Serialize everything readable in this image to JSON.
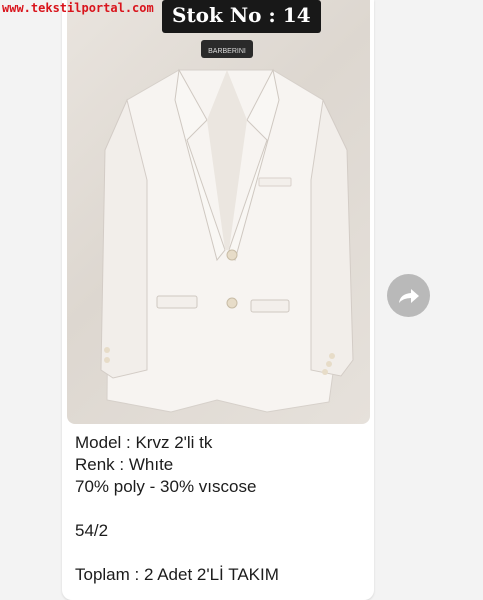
{
  "watermark": "www.tekstilportal.com",
  "badge": {
    "label": "Stok No : 14"
  },
  "photo": {
    "hanger_brand": "BARBERINI",
    "icon": "suit-jacket-photo"
  },
  "forward": {
    "icon": "forward-arrow-icon"
  },
  "caption": {
    "model": "Model : Krvz 2'li tk",
    "color": "Renk : Whıte",
    "fabric": "70% poly - 30% vıscose",
    "size": "54/2",
    "total": "Toplam : 2 Adet 2'Lİ TAKIM"
  },
  "colors": {
    "badge_bg": "#181818",
    "watermark": "#d9141c",
    "forward_btn": "#b9b9b9"
  }
}
